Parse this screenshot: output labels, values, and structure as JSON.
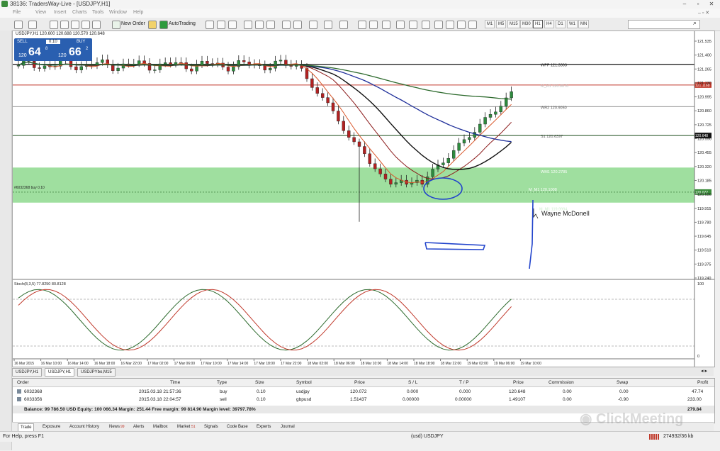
{
  "window": {
    "title": "38136: TradersWay-Live - [USDJPY,H1]",
    "minimize": "–",
    "restore": "▫",
    "close": "✕"
  },
  "menu": [
    "File",
    "View",
    "Insert",
    "Charts",
    "Tools",
    "Window",
    "Help"
  ],
  "toolbar": {
    "new_order": "New Order",
    "autotrading": "AutoTrading",
    "timeframes": [
      "M1",
      "M5",
      "M15",
      "M30",
      "H1",
      "H4",
      "D1",
      "W1",
      "MN"
    ],
    "active_timeframe": "H1"
  },
  "chart": {
    "header": "USDJPY,H1  120.600 120.688 120.570 120.648",
    "quick_trade": {
      "sell": "SELL",
      "buy": "BUY",
      "lot": "0.10",
      "sell_prefix": "120",
      "sell_big": "64",
      "sell_sup": "8",
      "buy_prefix": "120",
      "buy_big": "66",
      "buy_sup": "2"
    },
    "price_labels": [
      "121.535",
      "121.400",
      "121.265",
      "121.130",
      "120.995",
      "120.860",
      "120.725",
      "120.590",
      "120.455",
      "120.320",
      "120.185",
      "120.050",
      "119.915",
      "119.780",
      "119.645",
      "119.510",
      "119.375",
      "119.240"
    ],
    "current_price": "120.648",
    "levels": {
      "wpp": "WPP 121.3303",
      "mr1": "M_R1 120.0070",
      "wr2": "WR2 120.9050",
      "s1": "S1 120.6397",
      "wm1": "WM1 120.2785",
      "m1": "M_M1 120.1008",
      "m_lower": "M_M1 119.9994",
      "order": "#6032368 buy 0.10",
      "right_red": "121.1168",
      "right_green": "120.072"
    },
    "annotation": "Wayne McDonell",
    "stoch_title": "Stoch(8,3,5) 77.8250 80.8128",
    "stoch_scale_top": "100",
    "stoch_scale_bottom": "0",
    "time_labels": [
      "16 Mar 2015",
      "16 Mar 10:00",
      "16 Mar 14:00",
      "16 Mar 18:00",
      "16 Mar 22:00",
      "17 Mar 02:00",
      "17 Mar 06:00",
      "17 Mar 10:00",
      "17 Mar 14:00",
      "17 Mar 18:00",
      "17 Mar 22:00",
      "18 Mar 02:00",
      "18 Mar 06:00",
      "18 Mar 10:00",
      "18 Mar 14:00",
      "18 Mar 18:00",
      "18 Mar 22:00",
      "19 Mar 02:00",
      "19 Mar 06:00",
      "19 Mar 10:00"
    ]
  },
  "chart_tabs": [
    "USDJPY,H1",
    "USDJPY,H1",
    "USDJPYbo,M15"
  ],
  "terminal": {
    "columns": [
      "Order",
      "Time",
      "Type",
      "Size",
      "Symbol",
      "Price",
      "S / L",
      "T / P",
      "Price",
      "Commission",
      "Swap",
      "Profit"
    ],
    "rows": [
      [
        "6032368",
        "2015.03.18 21:57:36",
        "buy",
        "0.10",
        "usdjpy",
        "120.072",
        "0.000",
        "0.000",
        "120.648",
        "0.00",
        "0.00",
        "47.74"
      ],
      [
        "6033356",
        "2015.03.18 22:04:57",
        "sell",
        "0.10",
        "gbpusd",
        "1.51437",
        "0.00000",
        "0.00000",
        "1.49107",
        "0.00",
        "-0.90",
        "233.00"
      ]
    ],
    "balance": "Balance: 99 786.50 USD  Equity: 100 066.34  Margin: 251.44  Free margin: 99 814.90  Margin level: 39797.78%",
    "total": "279.84",
    "tabs": [
      "Trade",
      "Exposure",
      "Account History",
      "News",
      "Alerts",
      "Mailbox",
      "Market",
      "Signals",
      "Code Base",
      "Experts",
      "Journal"
    ],
    "news_badge": "99",
    "market_badge": "51"
  },
  "status": {
    "help": "For Help, press F1",
    "symbol": "(usd) USDJPY",
    "traffic": "274932/36 kb"
  },
  "watermark": "ClickMeeting"
}
